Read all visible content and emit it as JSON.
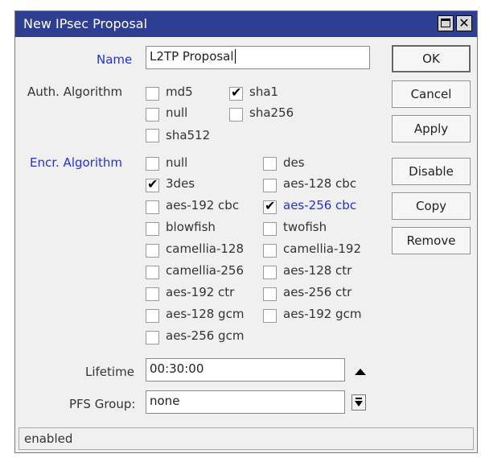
{
  "window": {
    "title": "New IPsec Proposal"
  },
  "form": {
    "name_label": "Name",
    "name_value": "L2TP Proposal",
    "auth_label": "Auth. Algorithm",
    "auth_options": [
      {
        "label": "md5",
        "checked": false
      },
      {
        "label": "sha1",
        "checked": true
      },
      {
        "label": "null",
        "checked": false
      },
      {
        "label": "sha256",
        "checked": false
      },
      {
        "label": "sha512",
        "checked": false
      }
    ],
    "encr_label": "Encr. Algorithm",
    "encr_options": [
      {
        "label": "null",
        "checked": false
      },
      {
        "label": "des",
        "checked": false
      },
      {
        "label": "3des",
        "checked": true
      },
      {
        "label": "aes-128 cbc",
        "checked": false
      },
      {
        "label": "aes-192 cbc",
        "checked": false
      },
      {
        "label": "aes-256 cbc",
        "checked": true
      },
      {
        "label": "blowfish",
        "checked": false
      },
      {
        "label": "twofish",
        "checked": false
      },
      {
        "label": "camellia-128",
        "checked": false
      },
      {
        "label": "camellia-192",
        "checked": false
      },
      {
        "label": "camellia-256",
        "checked": false
      },
      {
        "label": "aes-128 ctr",
        "checked": false
      },
      {
        "label": "aes-192 ctr",
        "checked": false
      },
      {
        "label": "aes-256 ctr",
        "checked": false
      },
      {
        "label": "aes-128 gcm",
        "checked": false
      },
      {
        "label": "aes-192 gcm",
        "checked": false
      },
      {
        "label": "aes-256 gcm",
        "checked": false
      }
    ],
    "lifetime_label": "Lifetime",
    "lifetime_value": "00:30:00",
    "pfs_label": "PFS Group:",
    "pfs_value": "none"
  },
  "buttons": {
    "ok": "OK",
    "cancel": "Cancel",
    "apply": "Apply",
    "disable": "Disable",
    "copy": "Copy",
    "remove": "Remove"
  },
  "status": {
    "text": "enabled"
  },
  "colors": {
    "titlebar": "#2d3e93",
    "highlight_label": "#2430d8"
  },
  "check_glyph": "✔"
}
